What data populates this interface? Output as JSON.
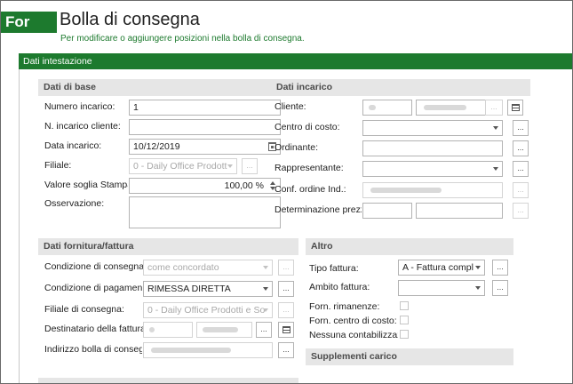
{
  "header": {
    "logo": "For",
    "title": "Bolla di consegna",
    "subtitle": "Per modificare o aggiungere posizioni nella bolla di consegna."
  },
  "bar": {
    "title": "Dati intestazione"
  },
  "base": {
    "title": "Dati di base",
    "numero_label": "Numero incarico:",
    "numero_value": "1",
    "ncliente_label": "N. incarico cliente:",
    "ncliente_value": "",
    "data_label": "Data incarico:",
    "data_value": "10/12/2019",
    "filiale_label": "Filiale:",
    "filiale_value": "0 - Daily Office Prodott",
    "soglia_label": "Valore soglia Stampa s",
    "soglia_value": "100,00 %",
    "osservazione_label": "Osservazione:",
    "osservazione_value": ""
  },
  "incarico": {
    "title": "Dati incarico",
    "cliente_label": "Cliente:",
    "centro_label": "Centro di costo:",
    "ordinante_label": "Ordinante:",
    "rappresentante_label": "Rappresentante:",
    "conf_label": "Conf. ordine Ind.:",
    "determ_label": "Determinazione prezzo"
  },
  "fornitura": {
    "title": "Dati fornitura/fattura",
    "condizione_label": "Condizione di consegna:",
    "condizione_value": "come concordato",
    "pagamento_label": "Condizione di pagamento",
    "pagamento_value": "RIMESSA DIRETTA",
    "filiale_label": "Filiale di consegna:",
    "filiale_value": "0 - Daily Office Prodotti e So",
    "destinatario_label": "Destinatario della fattura:",
    "indirizzo_label": "Indirizzo bolla di consegn"
  },
  "altro": {
    "title": "Altro",
    "tipo_label": "Tipo fattura:",
    "tipo_value": "A - Fattura compl",
    "ambito_label": "Ambito fattura:",
    "ambito_value": "",
    "rimanenze_label": "Forn. rimanenze:",
    "centro_label": "Forn. centro di costo:",
    "nessuna_label": "Nessuna contabilizzazi"
  },
  "supplementi": {
    "title": "Supplementi carico"
  },
  "buttons": {
    "ellipsis": "..."
  },
  "colors": {
    "brand": "#1d7a2e",
    "section_bg": "#e6e6e6"
  }
}
